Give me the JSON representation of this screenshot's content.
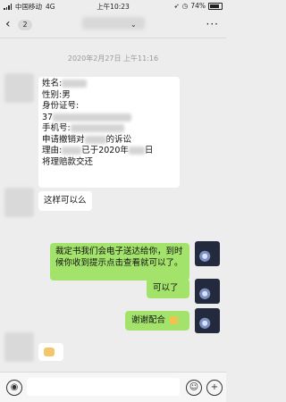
{
  "status": {
    "carrier": "中国移动",
    "network": "4G",
    "time": "上午10:23",
    "battery": "74%"
  },
  "nav": {
    "back_badge": "2",
    "more": "···"
  },
  "conversation": {
    "timestamp": "2020年2月27日 上午11:16",
    "messages": [
      {
        "from": "other",
        "lines": [
          "姓名:",
          "性别:男",
          "身份证号:",
          "37",
          "手机号:",
          "申请撤销对",
          "的诉讼",
          "理由:",
          "已于2020年",
          "日",
          "将理赔款交还"
        ]
      },
      {
        "from": "other",
        "text": "这样可以么"
      },
      {
        "from": "me",
        "text": "裁定书我们会电子送达给你，到时候你收到提示点击查看就可以了。"
      },
      {
        "from": "me",
        "text": "可以了"
      },
      {
        "from": "me",
        "text": "谢谢配合"
      }
    ]
  },
  "input": {
    "voice_icon": "voice-icon",
    "emoji_icon": "emoji-icon",
    "plus_icon": "plus-icon"
  }
}
